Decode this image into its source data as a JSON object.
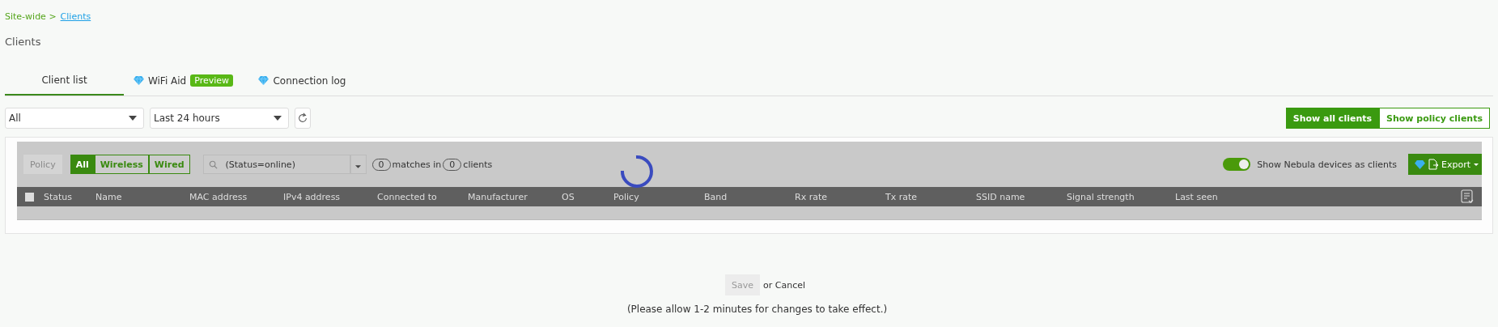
{
  "breadcrumb": {
    "parent": "Site-wide >",
    "current": "Clients"
  },
  "title": "Clients",
  "tabs": [
    {
      "label": "Client list",
      "premium": false,
      "selected": true
    },
    {
      "label": "WiFi Aid",
      "premium": true,
      "badge": "Preview",
      "selected": false
    },
    {
      "label": "Connection log",
      "premium": true,
      "selected": false
    }
  ],
  "filters": [
    {
      "value": "All"
    },
    {
      "value": "Last 24 hours"
    }
  ],
  "view_buttons": [
    {
      "label": "Show all clients",
      "selected": true
    },
    {
      "label": "Show policy clients",
      "selected": false
    }
  ],
  "toolbar": {
    "policy_button": {
      "label": "Policy",
      "disabled": true
    },
    "type_filter": [
      {
        "label": "All",
        "selected": true
      },
      {
        "label": "Wireless",
        "selected": false
      },
      {
        "label": "Wired",
        "selected": false
      }
    ],
    "search": {
      "value": "(Status=online)"
    },
    "matches": "0",
    "matches_text": "matches in",
    "clients": "0",
    "clients_text": "clients",
    "nebula_toggle": {
      "label": "Show Nebula devices as clients",
      "on": true
    },
    "export": "Export"
  },
  "table": {
    "select_all_checked": false,
    "loading": true,
    "columns": [
      "Status",
      "Name",
      "MAC address",
      "IPv4 address",
      "Connected to",
      "Manufacturer",
      "OS",
      "Policy",
      "Band",
      "Rx rate",
      "Tx rate",
      "SSID name",
      "Signal strength",
      "Last seen"
    ]
  },
  "footer": {
    "save": {
      "label": "Save",
      "disabled": true
    },
    "cancel_text": "or Cancel",
    "note": "(Please allow 1-2 minutes for changes to take effect.)"
  }
}
